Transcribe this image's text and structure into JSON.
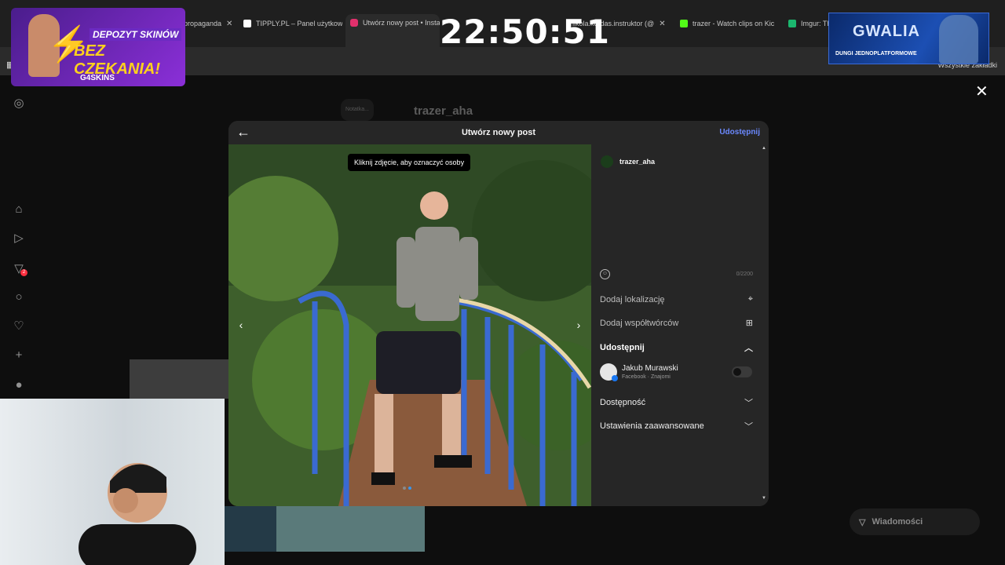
{
  "browser": {
    "tabs": [
      {
        "title": "propaganda",
        "favicon_color": "#e8e8e8"
      },
      {
        "title": "TIPPLY.PL – Panel użytkownika",
        "favicon_color": "#ffffff"
      },
      {
        "title": "Utwórz nowy post • Instagram",
        "favicon_color": "#e1306c"
      },
      {
        "title": "nikola.kordas.instruktor (@",
        "favicon_color": "#e1306c"
      },
      {
        "title": "trazer - Watch clips on Kick",
        "favicon_color": "#53fc18"
      },
      {
        "title": "Imgur: The",
        "favicon_color": "#1bb76e"
      }
    ],
    "bookmarks_label": "Wszystkie zakładki"
  },
  "stream": {
    "clock": "22:50:51",
    "promo": {
      "line1": "DEPOZYT SKINÓW",
      "line2": "BEZ CZEKANIA!",
      "logo": "G4SKINS"
    },
    "gwalia": {
      "title": "GWALIA",
      "subtitle": "DUNGI JEDNOPLATFORMOWE"
    }
  },
  "instagram": {
    "bg_username": "trazer_aha",
    "bg_chip": "Notatka...",
    "messages_label": "Wiadomości",
    "sidebar_badge": "2",
    "modal": {
      "title": "Utwórz nowy post",
      "share_label": "Udostępnij",
      "tag_tip": "Kliknij zdjęcie, aby oznaczyć osoby",
      "username": "trazer_aha",
      "char_counter": "0/2200",
      "add_location": "Dodaj lokalizację",
      "add_collaborators": "Dodaj współtwórców",
      "share_section": "Udostępnij",
      "account_name": "Jakub Murawski",
      "account_sub": "Facebook · Znajomi",
      "accessibility": "Dostępność",
      "advanced": "Ustawienia zaawansowane"
    }
  },
  "colors": {
    "accent": "#6b89ff",
    "modal_bg": "#262626",
    "page_bg": "#0e0e0e"
  }
}
